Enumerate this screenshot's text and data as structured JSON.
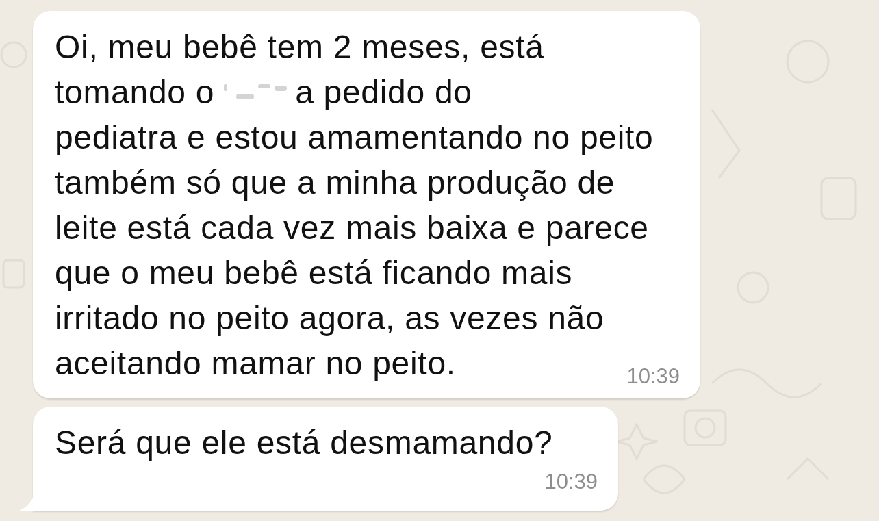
{
  "messages": [
    {
      "lines": [
        {
          "kind": "text",
          "text": "Oi, meu bebê tem 2 meses, está"
        },
        {
          "kind": "redacted",
          "before": "tomando o",
          "after": "a pedido do"
        },
        {
          "kind": "text",
          "text": "pediatra e estou amamentando no peito"
        },
        {
          "kind": "text",
          "text": "também só que a minha produção de"
        },
        {
          "kind": "text",
          "text": "leite está cada vez mais baixa e parece"
        },
        {
          "kind": "text",
          "text": "que o meu bebê está ficando mais"
        },
        {
          "kind": "text",
          "text": "irritado no peito agora, as vezes não"
        },
        {
          "kind": "text",
          "text": "aceitando mamar no peito."
        }
      ],
      "time": "10:39",
      "tail": false
    },
    {
      "lines": [
        {
          "kind": "text",
          "text": "Será que ele está desmamando?"
        }
      ],
      "time": "10:39",
      "tail": true
    }
  ]
}
